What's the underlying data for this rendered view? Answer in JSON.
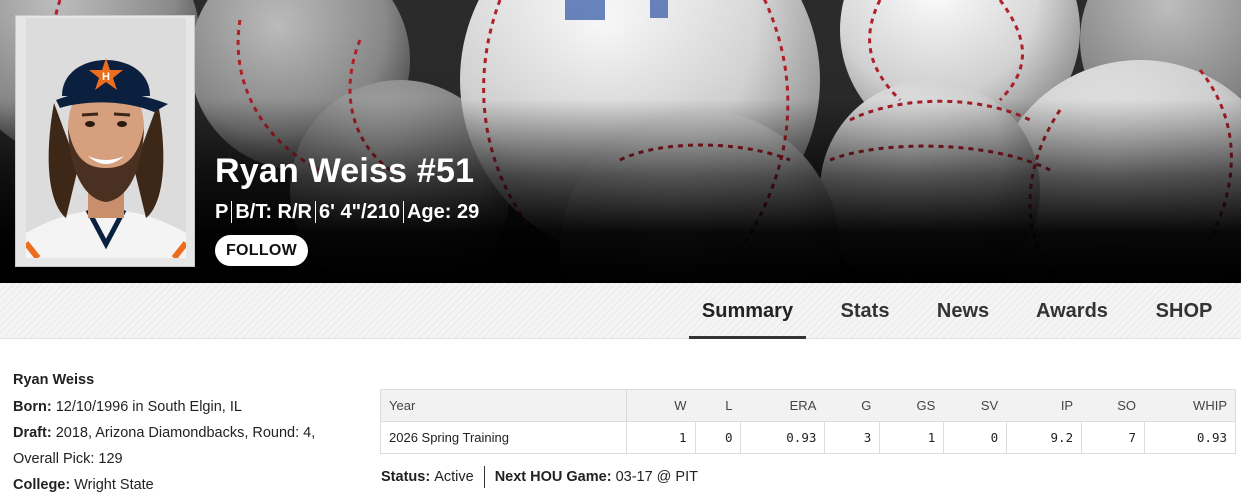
{
  "player": {
    "name_number": "Ryan Weiss #51",
    "position": "P",
    "bats_throws": "B/T: R/R",
    "height_weight": "6' 4\"/210",
    "age": "Age: 29",
    "follow_label": "FOLLOW"
  },
  "tabs": [
    "Summary",
    "Stats",
    "News",
    "Awards",
    "SHOP"
  ],
  "active_tab": "Summary",
  "bio": {
    "full_name": "Ryan Weiss",
    "born_label": "Born:",
    "born_value": "12/10/1996 in South Elgin, IL",
    "draft_label": "Draft:",
    "draft_value": "2018, Arizona Diamondbacks, Round: 4,",
    "draft_value_2": "Overall Pick: 129",
    "college_label": "College:",
    "college_value": "Wright State"
  },
  "stats_table": {
    "headers": [
      "Year",
      "W",
      "L",
      "ERA",
      "G",
      "GS",
      "SV",
      "IP",
      "SO",
      "WHIP"
    ],
    "rows": [
      [
        "2026 Spring Training",
        "1",
        "0",
        "0.93",
        "3",
        "1",
        "0",
        "9.2",
        "7",
        "0.93"
      ]
    ]
  },
  "status": {
    "status_label": "Status:",
    "status_value": "Active",
    "next_game_label": "Next HOU Game:",
    "next_game_value": "03-17 @ PIT"
  },
  "colors": {
    "hat_navy": "#0b1f3f",
    "astros_orange": "#eb6e1f",
    "seam_red": "#b3202a",
    "tab_active_underline": "#333333"
  }
}
